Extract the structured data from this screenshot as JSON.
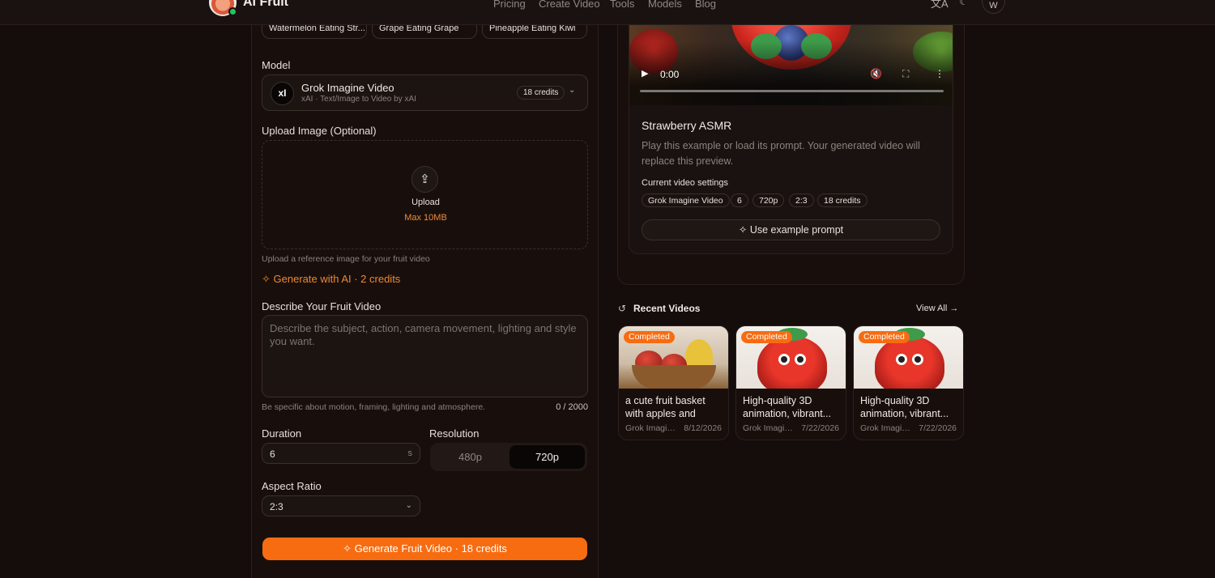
{
  "nav": {
    "brand": "AI Fruit",
    "links": [
      "Pricing",
      "Create Video",
      "Tools",
      "Models",
      "Blog"
    ],
    "user_initial": "W",
    "icons": [
      "translate-icon",
      "theme-moon-icon"
    ]
  },
  "examples": [
    "Watermelon Eating Str...",
    "Grape Eating Grape",
    "Pineapple Eating Kiwi"
  ],
  "model": {
    "label": "Model",
    "name": "Grok Imagine Video",
    "sub": "xAI · Text/Image to Video by xAI",
    "logo": "xI",
    "credits": "18 credits"
  },
  "upload": {
    "label": "Upload Image (Optional)",
    "button": "Upload",
    "max": "Max 10MB",
    "hint": "Upload a reference image for your fruit video",
    "generate_ai": "Generate with AI · 2 credits"
  },
  "describe": {
    "label": "Describe Your Fruit Video",
    "placeholder": "Describe the subject, action, camera movement, lighting and style you want.",
    "hint": "Be specific about motion, framing, lighting and atmosphere.",
    "counter": "0 / 2000"
  },
  "duration": {
    "label": "Duration",
    "value": "6",
    "unit": "s"
  },
  "resolution": {
    "label": "Resolution",
    "options": [
      "480p",
      "720p"
    ],
    "selected": "720p"
  },
  "aspect": {
    "label": "Aspect Ratio",
    "value": "2:3"
  },
  "generate_button": "Generate Fruit Video · 18 credits",
  "preview": {
    "time": "0:00",
    "title": "Strawberry ASMR",
    "description": "Play this example or load its prompt. Your generated video will replace this preview.",
    "settings_label": "Current video settings",
    "tags": [
      "Grok Imagine Video",
      "6",
      "720p",
      "2:3",
      "18 credits"
    ],
    "use_prompt": "Use example prompt"
  },
  "recent": {
    "title": "Recent Videos",
    "view_all": "View All →",
    "items": [
      {
        "status": "Completed",
        "title": "a cute fruit basket with apples and bananas...",
        "model": "Grok Imagin...",
        "date": "8/12/2026"
      },
      {
        "status": "Completed",
        "title": "High-quality 3D animation, vibrant...",
        "model": "Grok Imagin...",
        "date": "7/22/2026"
      },
      {
        "status": "Completed",
        "title": "High-quality 3D animation, vibrant...",
        "model": "Grok Imagin...",
        "date": "7/22/2026"
      }
    ]
  }
}
